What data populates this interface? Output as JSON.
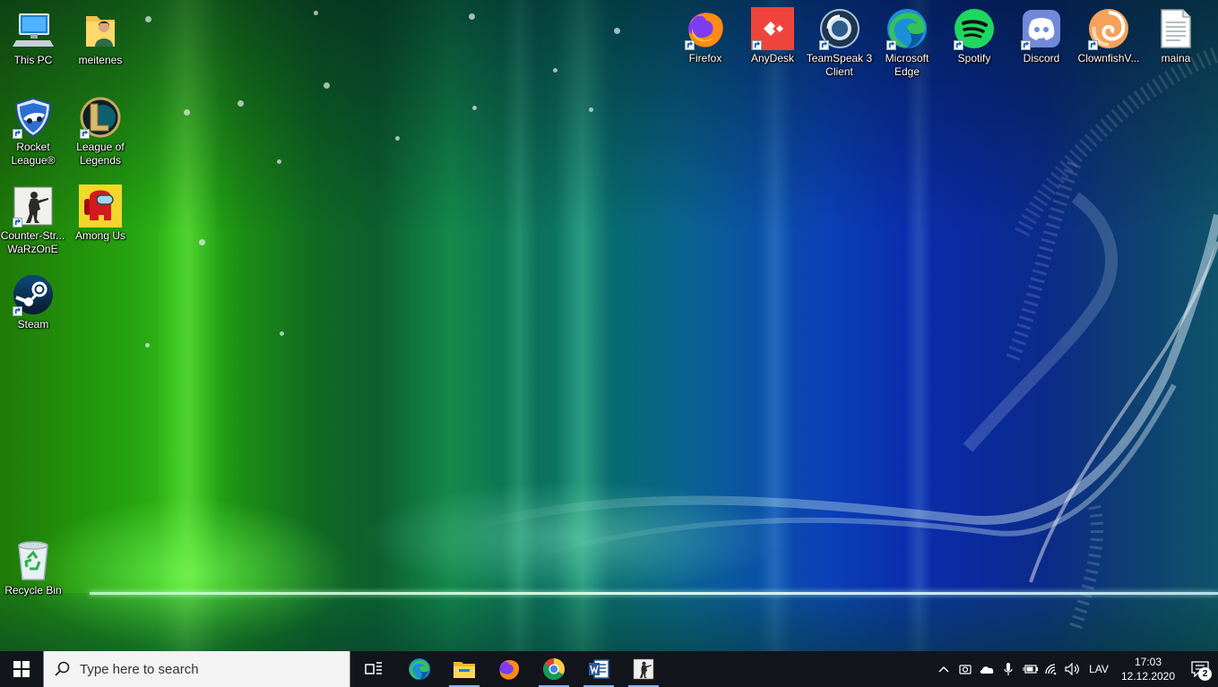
{
  "desktop": {
    "icons_left": [
      {
        "id": "this-pc",
        "label": "This PC",
        "icon": "this-pc-icon"
      },
      {
        "id": "meitenes",
        "label": "meitenes",
        "icon": "user-folder-icon"
      },
      {
        "id": "rocket-league",
        "label": "Rocket League®",
        "icon": "rocket-league-icon"
      },
      {
        "id": "league-of-legends",
        "label": "League of Legends",
        "icon": "league-of-legends-icon"
      },
      {
        "id": "counter-strike",
        "label": "Counter-Str... WaRzOnE",
        "icon": "counter-strike-icon"
      },
      {
        "id": "among-us",
        "label": "Among Us",
        "icon": "among-us-icon"
      },
      {
        "id": "steam",
        "label": "Steam",
        "icon": "steam-icon"
      },
      {
        "id": "recycle-bin",
        "label": "Recycle Bin",
        "icon": "recycle-bin-icon"
      }
    ],
    "icons_top": [
      {
        "id": "firefox",
        "label": "Firefox",
        "icon": "firefox-icon"
      },
      {
        "id": "anydesk",
        "label": "AnyDesk",
        "icon": "anydesk-icon"
      },
      {
        "id": "teamspeak",
        "label": "TeamSpeak 3 Client",
        "icon": "teamspeak-icon"
      },
      {
        "id": "edge",
        "label": "Microsoft Edge",
        "icon": "edge-icon"
      },
      {
        "id": "spotify",
        "label": "Spotify",
        "icon": "spotify-icon"
      },
      {
        "id": "discord",
        "label": "Discord",
        "icon": "discord-icon"
      },
      {
        "id": "clownfish",
        "label": "ClownfishV...",
        "icon": "clownfish-icon"
      },
      {
        "id": "maina",
        "label": "maina",
        "icon": "text-file-icon"
      }
    ]
  },
  "taskbar": {
    "search_placeholder": "Type here to search",
    "pinned": [
      {
        "id": "task-view",
        "icon": "task-view-icon"
      },
      {
        "id": "edge",
        "icon": "edge-icon"
      },
      {
        "id": "file-explorer",
        "icon": "file-explorer-icon"
      },
      {
        "id": "firefox",
        "icon": "firefox-icon"
      },
      {
        "id": "chrome",
        "icon": "chrome-icon"
      },
      {
        "id": "word",
        "icon": "word-icon"
      },
      {
        "id": "counter-strike",
        "icon": "counter-strike-icon"
      }
    ],
    "tray": {
      "language": "LAV",
      "time": "17:03",
      "date": "12.12.2020",
      "notification_count": "2"
    }
  },
  "colors": {
    "taskbar_bg": "#13151c",
    "search_bg": "#f3f3f3",
    "running_indicator": "#8ab4f8"
  }
}
